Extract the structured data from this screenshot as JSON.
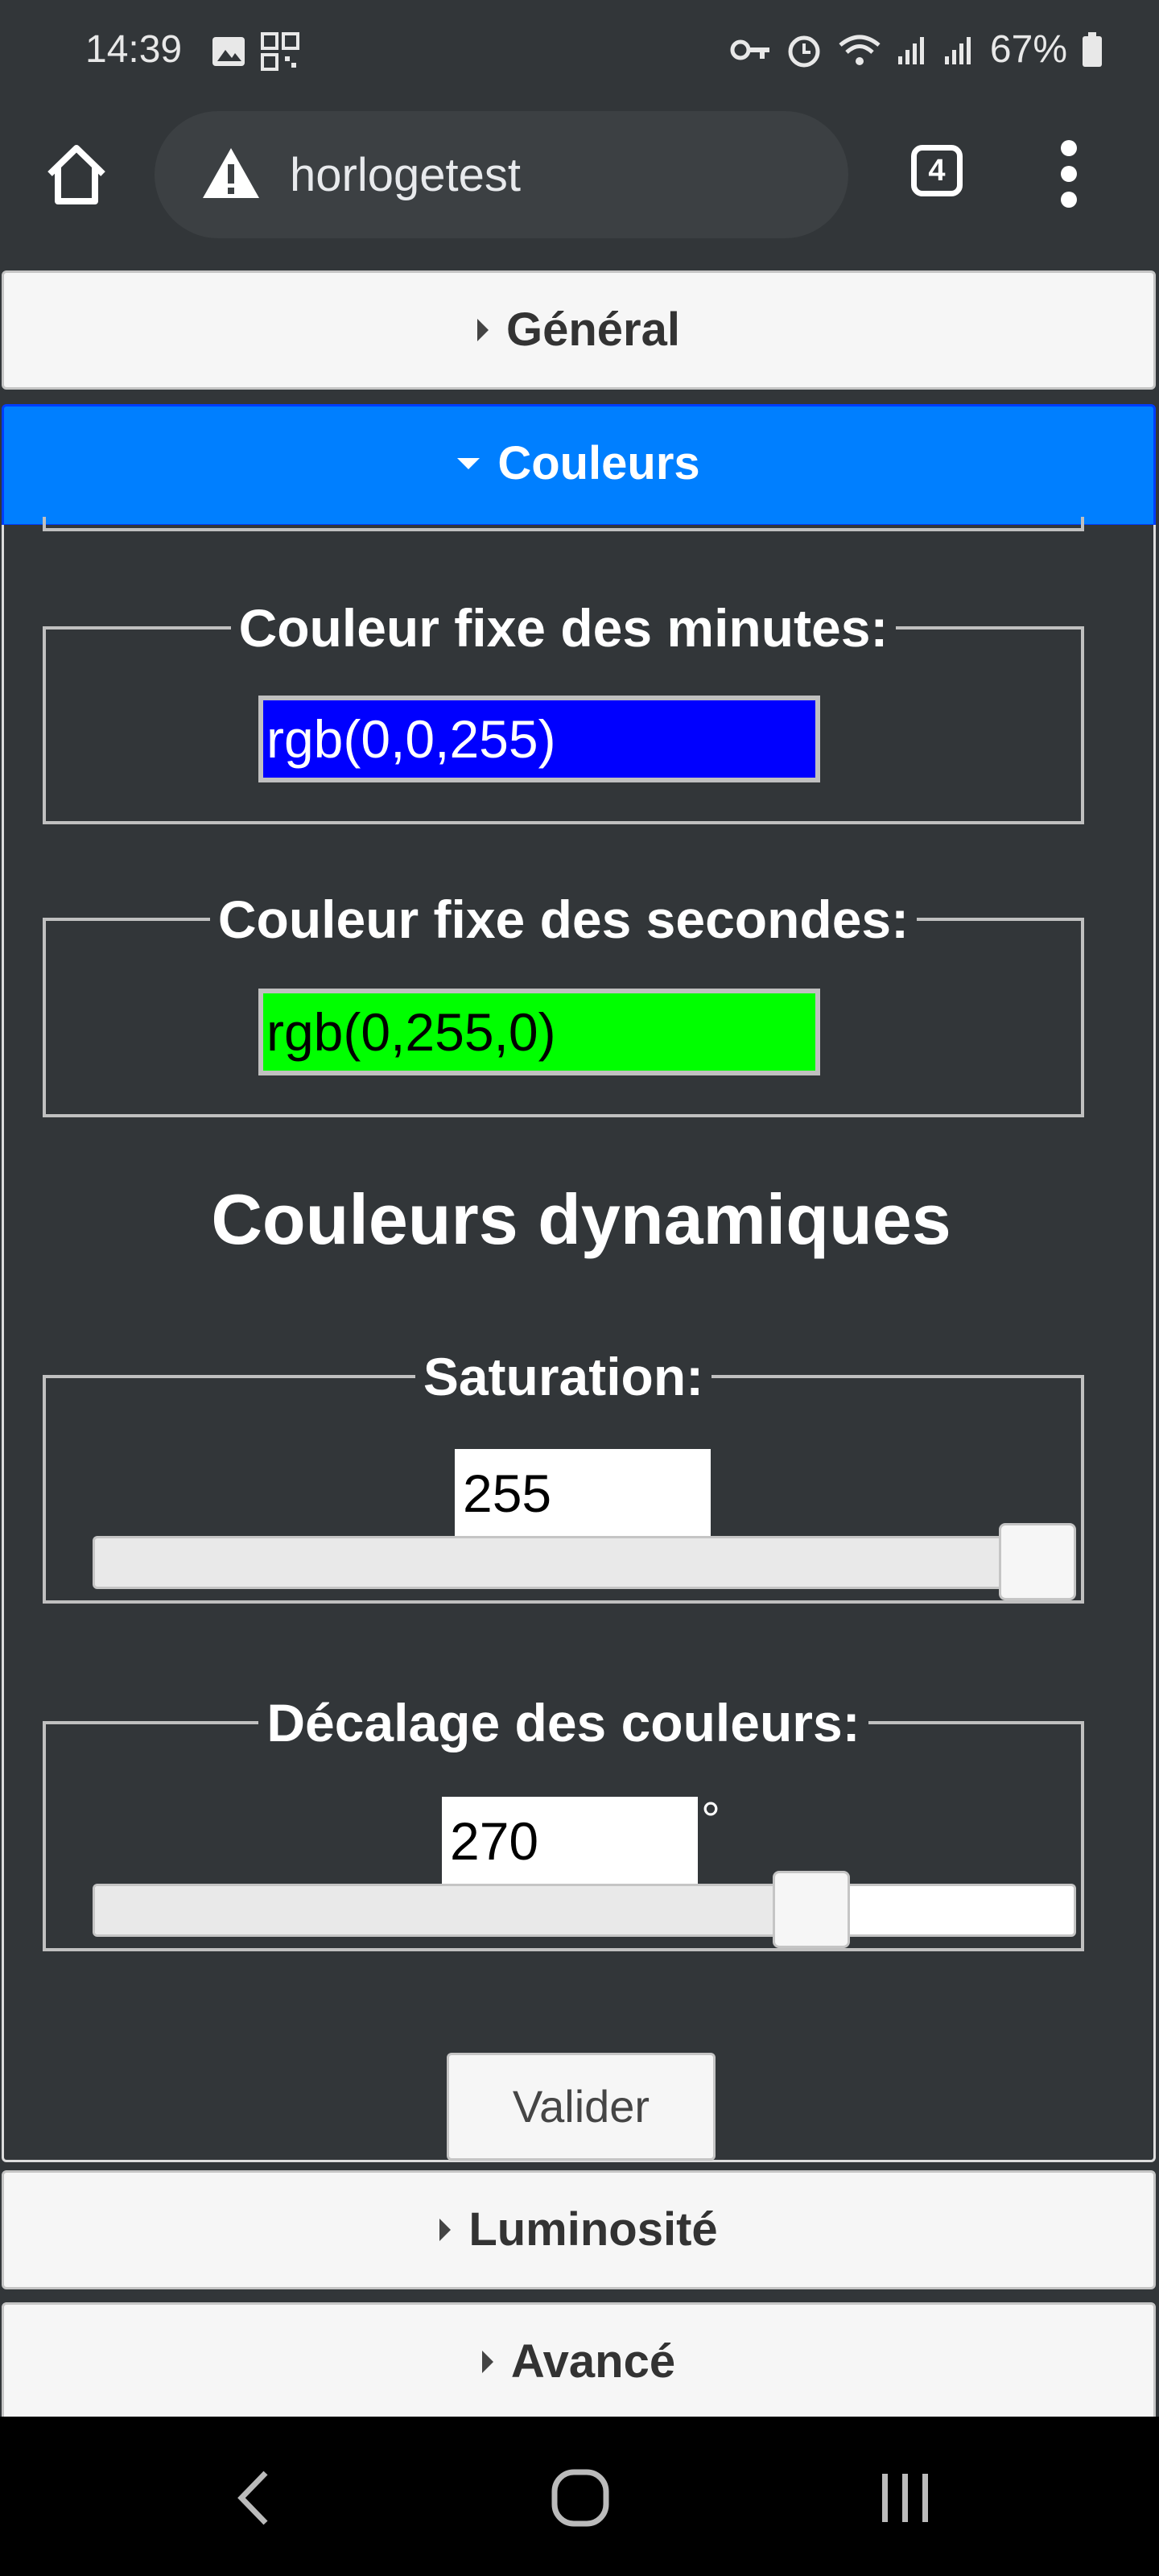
{
  "status_bar": {
    "time": "14:39",
    "battery": "67%"
  },
  "browser": {
    "url": "horlogetest",
    "tab_count": "4"
  },
  "accordion": {
    "general": "Général",
    "couleurs": "Couleurs",
    "luminosite": "Luminosité",
    "avance": "Avancé"
  },
  "couleurs": {
    "minutes_legend": "Couleur fixe des minutes:",
    "minutes_value": "rgb(0,0,255)",
    "minutes_color": "#0000ff",
    "secondes_legend": "Couleur fixe des secondes:",
    "secondes_value": "rgb(0,255,0)",
    "secondes_color": "#00ff00",
    "dynamic_title": "Couleurs dynamiques",
    "saturation_legend": "Saturation:",
    "saturation_value": "255",
    "saturation_fraction": 1.0,
    "decalage_legend": "Décalage des couleurs:",
    "decalage_value": "270",
    "decalage_unit": "°",
    "decalage_fraction": 0.75,
    "submit_label": "Valider"
  },
  "colors": {
    "accent": "#007fff",
    "background": "#323639"
  },
  "icons": [
    "image-icon",
    "qr-code-icon",
    "key-icon",
    "alarm-icon",
    "wifi-icon",
    "signal-icon",
    "battery-icon",
    "home-icon",
    "warning-icon",
    "tabs-icon",
    "overflow-menu-icon",
    "back-icon",
    "home-nav-icon",
    "recents-icon"
  ]
}
